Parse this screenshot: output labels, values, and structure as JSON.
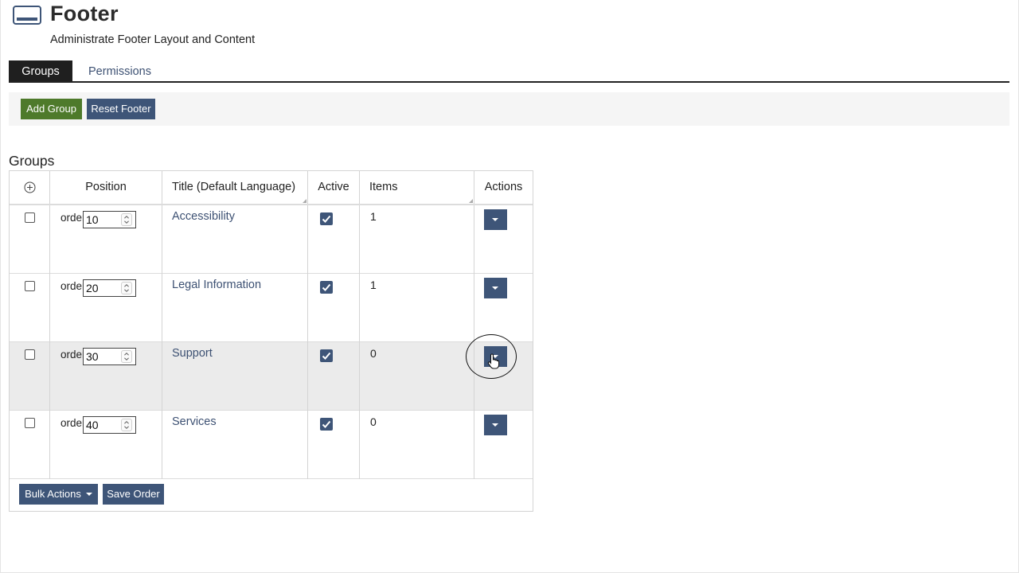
{
  "header": {
    "title": "Footer",
    "subtitle": "Administrate Footer Layout and Content",
    "icon": "footer-layout-icon"
  },
  "tabs": [
    {
      "label": "Groups",
      "active": true
    },
    {
      "label": "Permissions",
      "active": false
    }
  ],
  "toolbar": {
    "add_group": "Add Group",
    "reset_footer": "Reset Footer"
  },
  "section_title": "Groups",
  "table": {
    "columns": {
      "position": "Position",
      "title": "Title (Default Language)",
      "active": "Active",
      "items": "Items",
      "actions": "Actions"
    },
    "rows": [
      {
        "order_label": "order",
        "position": "10",
        "title": "Accessibility",
        "active": true,
        "items": "1"
      },
      {
        "order_label": "order",
        "position": "20",
        "title": "Legal Information",
        "active": true,
        "items": "1"
      },
      {
        "order_label": "order",
        "position": "30",
        "title": "Support",
        "active": true,
        "items": "0",
        "highlighted": true
      },
      {
        "order_label": "order",
        "position": "40",
        "title": "Services",
        "active": true,
        "items": "0"
      }
    ]
  },
  "footer_actions": {
    "bulk_actions": "Bulk Actions",
    "save_order": "Save Order"
  },
  "colors": {
    "primary": "#3e5578",
    "success": "#4e7a2b",
    "link": "#3d5173",
    "row_highlight": "#ebebeb"
  }
}
